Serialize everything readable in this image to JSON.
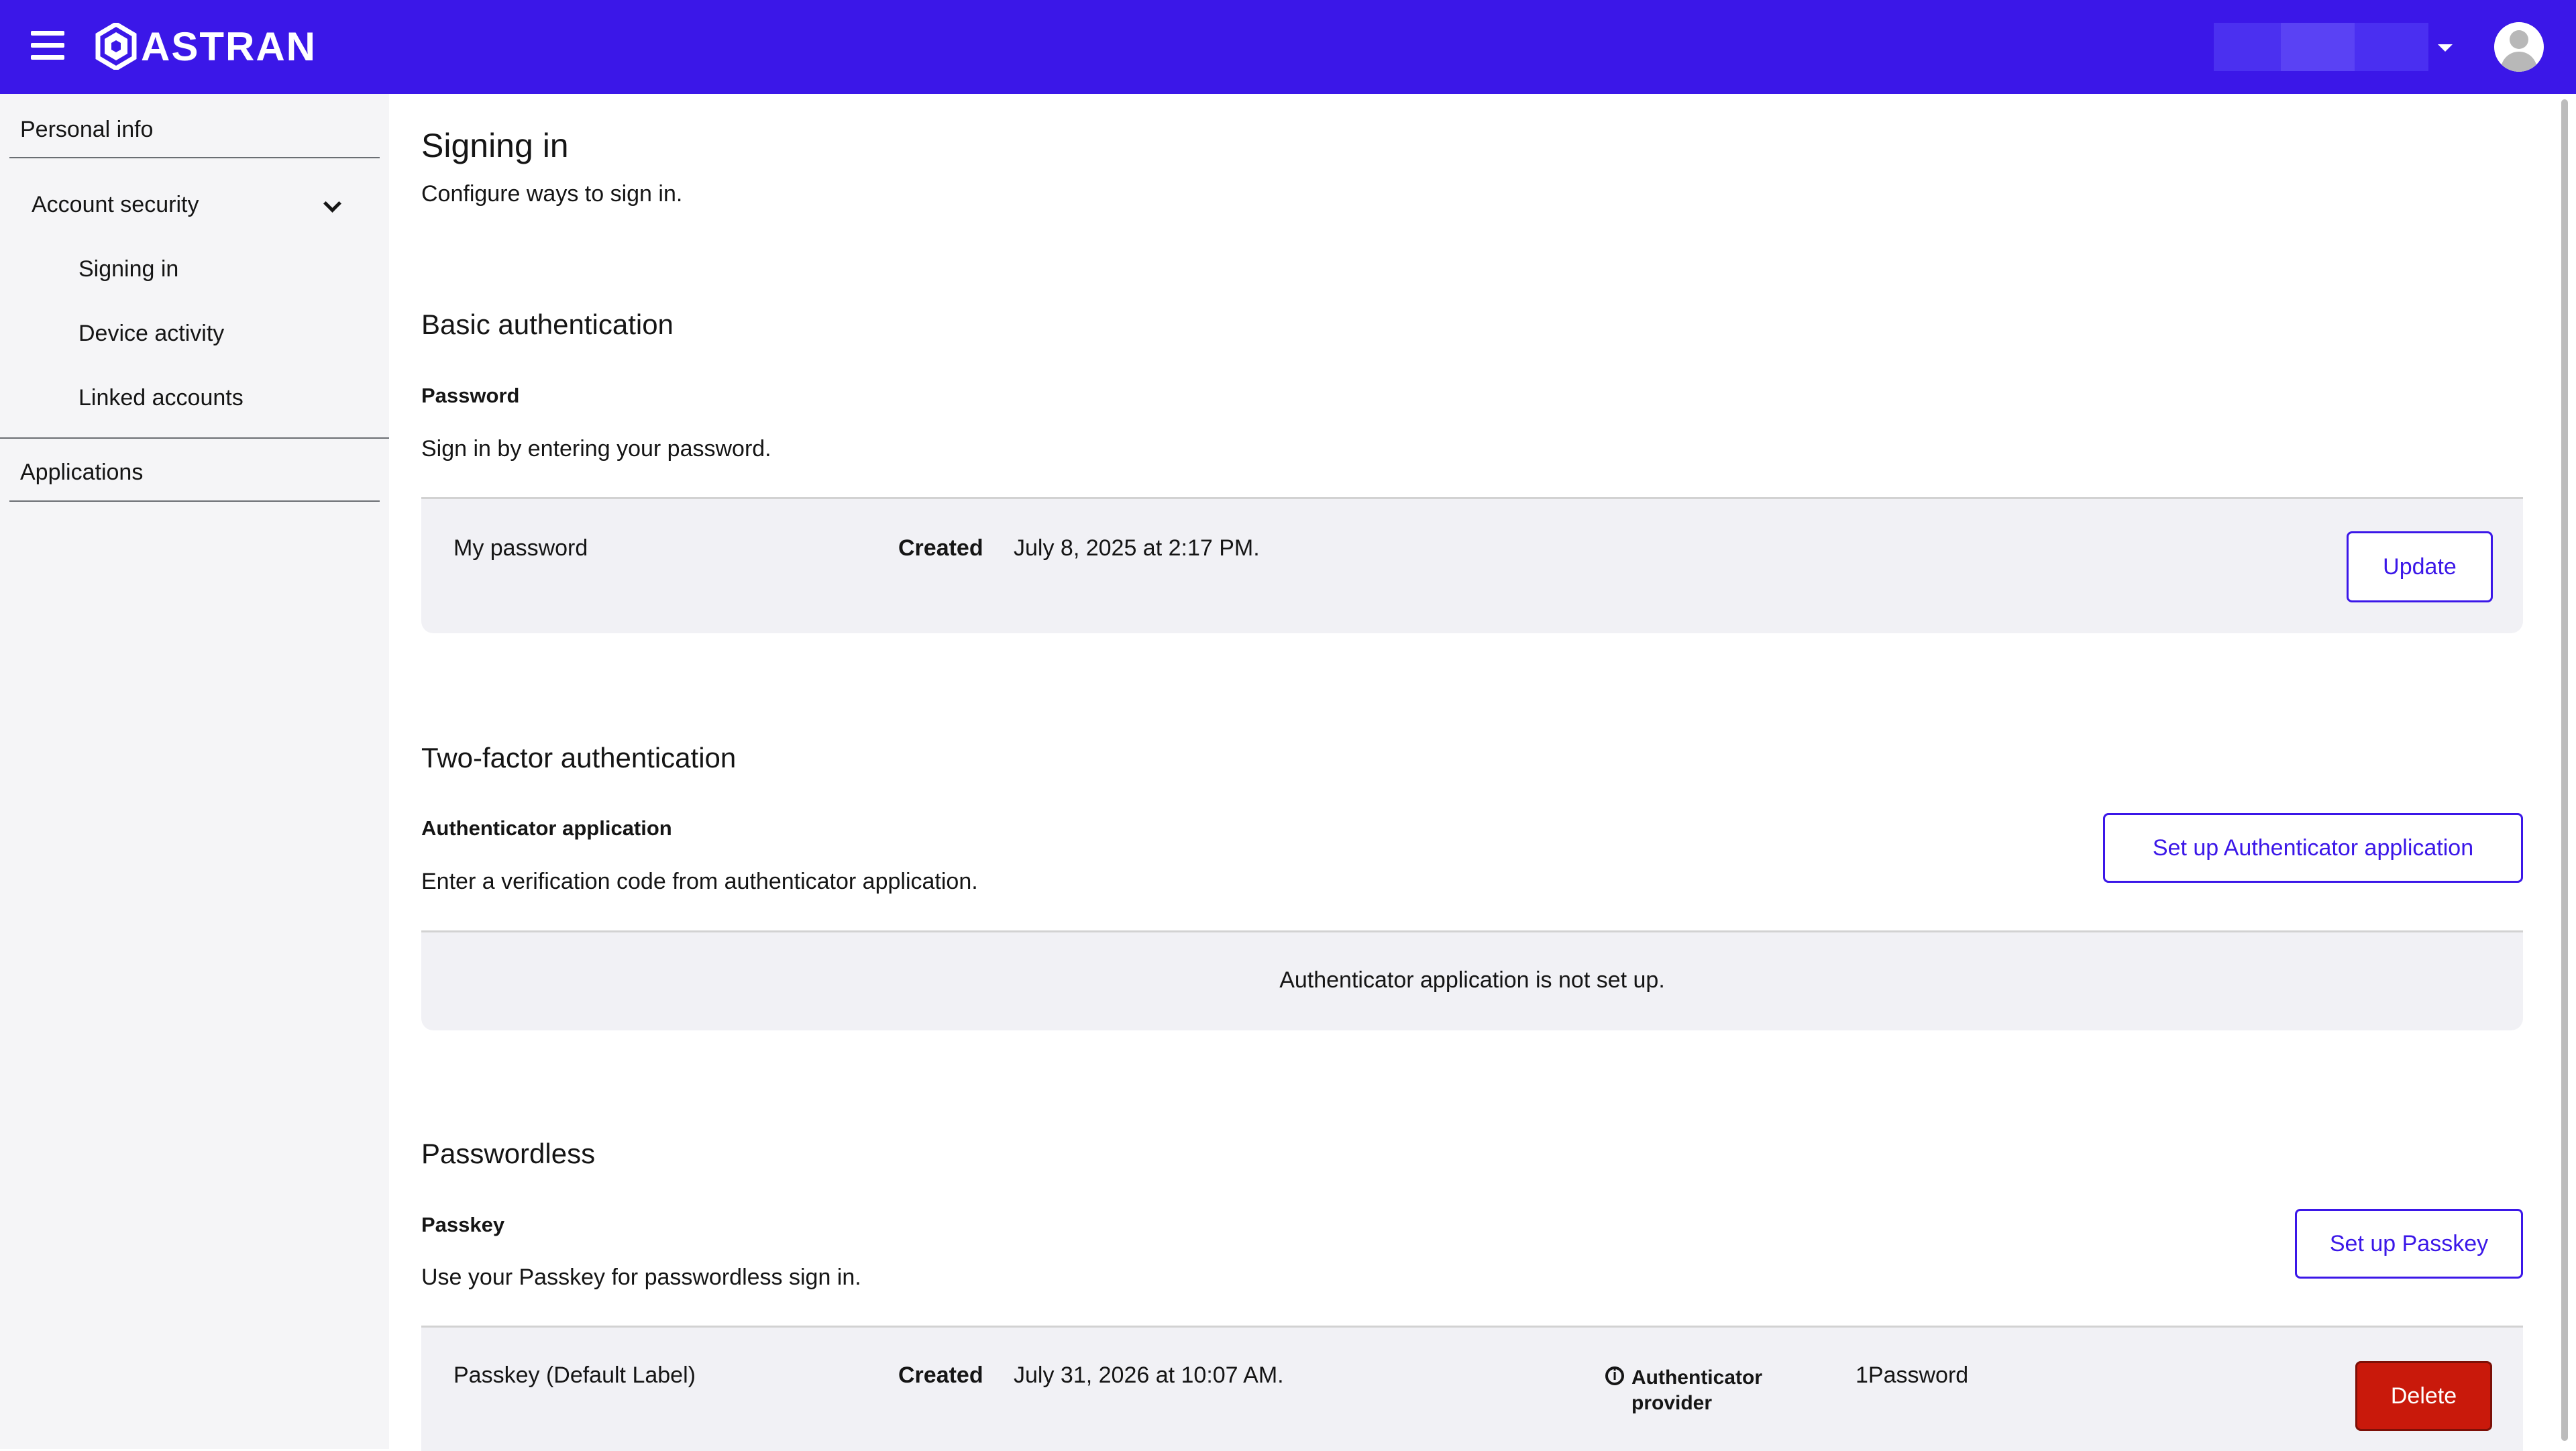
{
  "header": {
    "logo_text": "ASTRAN",
    "brand_color": "#3b17e8"
  },
  "sidebar": {
    "personal_info": "Personal info",
    "account_security": "Account security",
    "sub_items": [
      "Signing in",
      "Device activity",
      "Linked accounts"
    ],
    "applications": "Applications"
  },
  "page": {
    "title": "Signing in",
    "subtitle": "Configure ways to sign in."
  },
  "basic_auth": {
    "section_title": "Basic authentication",
    "label": "Password",
    "description": "Sign in by entering your password.",
    "row_name": "My password",
    "created_label": "Created",
    "created_value": "July 8, 2025 at 2:17 PM.",
    "update_button": "Update"
  },
  "two_factor": {
    "section_title": "Two-factor authentication",
    "label": "Authenticator application",
    "description": "Enter a verification code from authenticator application.",
    "setup_button": "Set up Authenticator application",
    "empty_text": "Authenticator application is not set up."
  },
  "passwordless": {
    "section_title": "Passwordless",
    "label": "Passkey",
    "description": "Use your Passkey for passwordless sign in.",
    "setup_button": "Set up Passkey",
    "row_name": "Passkey (Default Label)",
    "created_label": "Created",
    "created_value": "July 31, 2026 at 10:07 AM.",
    "provider_label_line1": "Authenticator",
    "provider_label_line2": "provider",
    "provider_value": "1Password",
    "delete_button": "Delete",
    "danger_color": "#c9190b"
  }
}
